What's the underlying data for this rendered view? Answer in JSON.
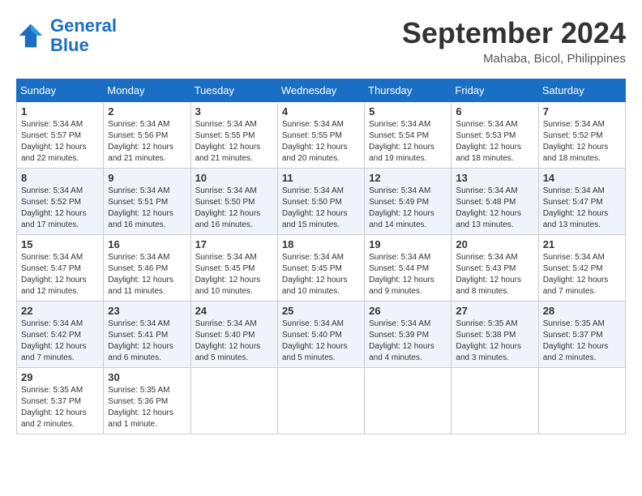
{
  "header": {
    "logo_line1": "General",
    "logo_line2": "Blue",
    "month": "September 2024",
    "location": "Mahaba, Bicol, Philippines"
  },
  "weekdays": [
    "Sunday",
    "Monday",
    "Tuesday",
    "Wednesday",
    "Thursday",
    "Friday",
    "Saturday"
  ],
  "weeks": [
    [
      {
        "day": "1",
        "sunrise": "5:34 AM",
        "sunset": "5:57 PM",
        "daylight": "12 hours and 22 minutes."
      },
      {
        "day": "2",
        "sunrise": "5:34 AM",
        "sunset": "5:56 PM",
        "daylight": "12 hours and 21 minutes."
      },
      {
        "day": "3",
        "sunrise": "5:34 AM",
        "sunset": "5:55 PM",
        "daylight": "12 hours and 21 minutes."
      },
      {
        "day": "4",
        "sunrise": "5:34 AM",
        "sunset": "5:55 PM",
        "daylight": "12 hours and 20 minutes."
      },
      {
        "day": "5",
        "sunrise": "5:34 AM",
        "sunset": "5:54 PM",
        "daylight": "12 hours and 19 minutes."
      },
      {
        "day": "6",
        "sunrise": "5:34 AM",
        "sunset": "5:53 PM",
        "daylight": "12 hours and 18 minutes."
      },
      {
        "day": "7",
        "sunrise": "5:34 AM",
        "sunset": "5:52 PM",
        "daylight": "12 hours and 18 minutes."
      }
    ],
    [
      {
        "day": "8",
        "sunrise": "5:34 AM",
        "sunset": "5:52 PM",
        "daylight": "12 hours and 17 minutes."
      },
      {
        "day": "9",
        "sunrise": "5:34 AM",
        "sunset": "5:51 PM",
        "daylight": "12 hours and 16 minutes."
      },
      {
        "day": "10",
        "sunrise": "5:34 AM",
        "sunset": "5:50 PM",
        "daylight": "12 hours and 16 minutes."
      },
      {
        "day": "11",
        "sunrise": "5:34 AM",
        "sunset": "5:50 PM",
        "daylight": "12 hours and 15 minutes."
      },
      {
        "day": "12",
        "sunrise": "5:34 AM",
        "sunset": "5:49 PM",
        "daylight": "12 hours and 14 minutes."
      },
      {
        "day": "13",
        "sunrise": "5:34 AM",
        "sunset": "5:48 PM",
        "daylight": "12 hours and 13 minutes."
      },
      {
        "day": "14",
        "sunrise": "5:34 AM",
        "sunset": "5:47 PM",
        "daylight": "12 hours and 13 minutes."
      }
    ],
    [
      {
        "day": "15",
        "sunrise": "5:34 AM",
        "sunset": "5:47 PM",
        "daylight": "12 hours and 12 minutes."
      },
      {
        "day": "16",
        "sunrise": "5:34 AM",
        "sunset": "5:46 PM",
        "daylight": "12 hours and 11 minutes."
      },
      {
        "day": "17",
        "sunrise": "5:34 AM",
        "sunset": "5:45 PM",
        "daylight": "12 hours and 10 minutes."
      },
      {
        "day": "18",
        "sunrise": "5:34 AM",
        "sunset": "5:45 PM",
        "daylight": "12 hours and 10 minutes."
      },
      {
        "day": "19",
        "sunrise": "5:34 AM",
        "sunset": "5:44 PM",
        "daylight": "12 hours and 9 minutes."
      },
      {
        "day": "20",
        "sunrise": "5:34 AM",
        "sunset": "5:43 PM",
        "daylight": "12 hours and 8 minutes."
      },
      {
        "day": "21",
        "sunrise": "5:34 AM",
        "sunset": "5:42 PM",
        "daylight": "12 hours and 7 minutes."
      }
    ],
    [
      {
        "day": "22",
        "sunrise": "5:34 AM",
        "sunset": "5:42 PM",
        "daylight": "12 hours and 7 minutes."
      },
      {
        "day": "23",
        "sunrise": "5:34 AM",
        "sunset": "5:41 PM",
        "daylight": "12 hours and 6 minutes."
      },
      {
        "day": "24",
        "sunrise": "5:34 AM",
        "sunset": "5:40 PM",
        "daylight": "12 hours and 5 minutes."
      },
      {
        "day": "25",
        "sunrise": "5:34 AM",
        "sunset": "5:40 PM",
        "daylight": "12 hours and 5 minutes."
      },
      {
        "day": "26",
        "sunrise": "5:34 AM",
        "sunset": "5:39 PM",
        "daylight": "12 hours and 4 minutes."
      },
      {
        "day": "27",
        "sunrise": "5:35 AM",
        "sunset": "5:38 PM",
        "daylight": "12 hours and 3 minutes."
      },
      {
        "day": "28",
        "sunrise": "5:35 AM",
        "sunset": "5:37 PM",
        "daylight": "12 hours and 2 minutes."
      }
    ],
    [
      {
        "day": "29",
        "sunrise": "5:35 AM",
        "sunset": "5:37 PM",
        "daylight": "12 hours and 2 minutes."
      },
      {
        "day": "30",
        "sunrise": "5:35 AM",
        "sunset": "5:36 PM",
        "daylight": "12 hours and 1 minute."
      },
      null,
      null,
      null,
      null,
      null
    ]
  ],
  "labels": {
    "sunrise": "Sunrise:",
    "sunset": "Sunset:",
    "daylight": "Daylight:"
  }
}
